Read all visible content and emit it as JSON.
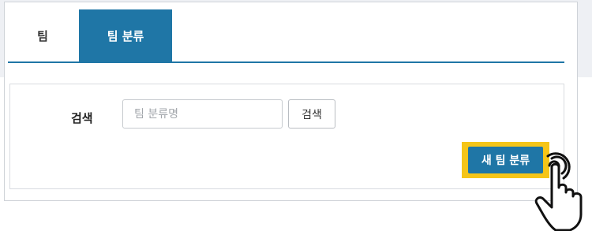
{
  "tabs": [
    {
      "label": "팀"
    },
    {
      "label": "팀 분류"
    }
  ],
  "search": {
    "label": "검색",
    "placeholder": "팀 분류명",
    "value": "",
    "button_label": "검색"
  },
  "actions": {
    "new_label": "새 팀 분류"
  },
  "colors": {
    "accent": "#1f76a6",
    "highlight": "#f5c518"
  },
  "icons": {
    "pointer": "hand-pointer-icon"
  }
}
